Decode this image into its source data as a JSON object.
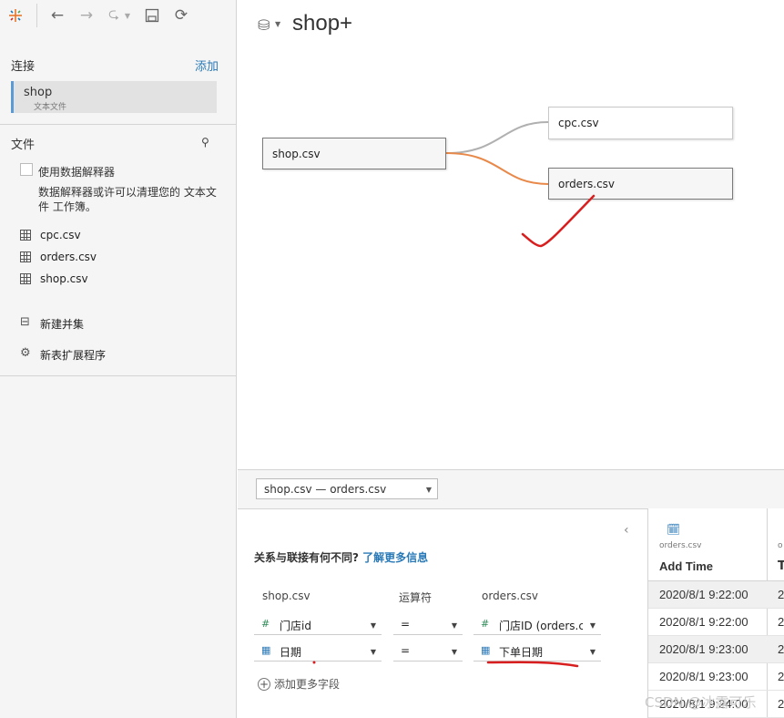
{
  "toolbar": {
    "logo_icon": "tableau-logo-icon",
    "back_icon": "back-arrow-icon",
    "forward_icon": "forward-arrow-icon",
    "redo_icon": "redo-icon",
    "save_icon": "save-icon",
    "refresh_icon": "refresh-icon"
  },
  "connections": {
    "title": "连接",
    "add_label": "添加",
    "items": [
      {
        "name": "shop",
        "type": "文本文件"
      }
    ]
  },
  "files": {
    "title": "文件",
    "interpreter_label": "使用数据解释器",
    "interpreter_checked": false,
    "interpreter_desc": "数据解释器或许可以清理您的 文本文件 工作簿。",
    "items": [
      "cpc.csv",
      "orders.csv",
      "shop.csv"
    ],
    "actions": [
      "新建并集",
      "新表扩展程序"
    ]
  },
  "canvas": {
    "datasource_title": "shop+",
    "tables": {
      "root": "shop.csv",
      "child1": "cpc.csv",
      "child2": "orders.csv"
    }
  },
  "relationship": {
    "selector": "shop.csv  —  orders.csv",
    "question": "关系与联接有何不同?",
    "learn_more": "了解更多信息",
    "columns": {
      "left": "shop.csv",
      "op": "运算符",
      "right": "orders.csv"
    },
    "rows": [
      {
        "left": "门店id",
        "left_type": "number",
        "op": "=",
        "right": "门店ID (orders.cs",
        "right_type": "number"
      },
      {
        "left": "日期",
        "left_type": "date",
        "op": "=",
        "right": "下单日期",
        "right_type": "date"
      }
    ],
    "add_more": "添加更多字段"
  },
  "grid": {
    "source": "orders.csv",
    "column": "Add Time",
    "next_source": "o",
    "next_column": "T",
    "rows": [
      {
        "v": "2020/8/1 9:22:00",
        "n": "2"
      },
      {
        "v": "2020/8/1 9:22:00",
        "n": "2"
      },
      {
        "v": "2020/8/1 9:23:00",
        "n": "2"
      },
      {
        "v": "2020/8/1 9:23:00",
        "n": "2"
      },
      {
        "v": "2020/8/1 9:24:00",
        "n": "2"
      }
    ]
  },
  "watermark": "CSDN @冰露可乐",
  "colors": {
    "accent": "#2a7ab8",
    "link_orange": "#e8894a",
    "link_gray": "#b0b0b0",
    "annotation_red": "#d81e1e"
  }
}
